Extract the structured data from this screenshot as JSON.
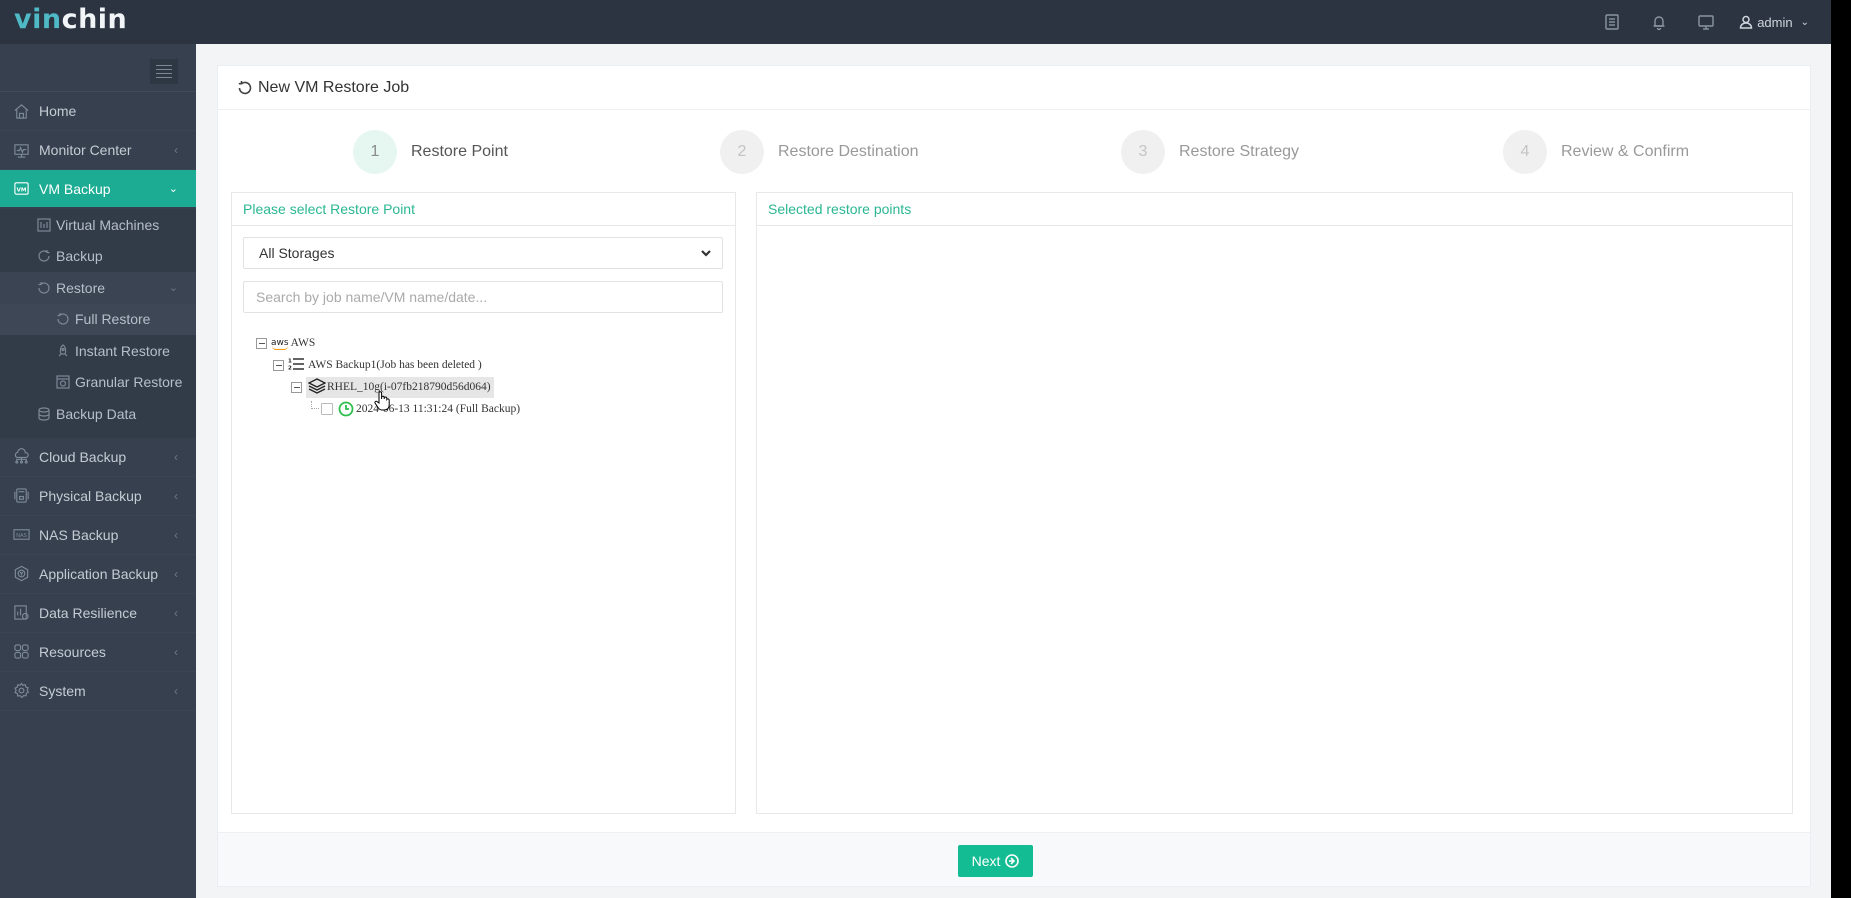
{
  "app": {
    "logo_part1": "vin",
    "logo_part2": "chin",
    "user_name": "admin"
  },
  "topbar_icons": [
    "task-list-icon",
    "bell-icon",
    "monitor-icon",
    "user-icon"
  ],
  "sidebar": {
    "items": [
      {
        "label": "Home",
        "icon": "home-icon"
      },
      {
        "label": "Monitor Center",
        "icon": "monitor-center-icon"
      },
      {
        "label": "VM Backup",
        "icon": "vm-icon",
        "active": true
      },
      {
        "label": "Cloud Backup",
        "icon": "cloud-icon"
      },
      {
        "label": "Physical Backup",
        "icon": "server-icon"
      },
      {
        "label": "NAS Backup",
        "icon": "nas-icon"
      },
      {
        "label": "Application Backup",
        "icon": "app-icon"
      },
      {
        "label": "Data Resilience",
        "icon": "data-resilience-icon"
      },
      {
        "label": "Resources",
        "icon": "resources-icon"
      },
      {
        "label": "System",
        "icon": "gear-icon"
      }
    ],
    "vm_backup_sub": [
      {
        "label": "Virtual Machines"
      },
      {
        "label": "Backup"
      },
      {
        "label": "Restore"
      },
      {
        "label": "Full Restore",
        "current": true
      },
      {
        "label": "Instant Restore"
      },
      {
        "label": "Granular Restore"
      },
      {
        "label": "Backup Data"
      }
    ]
  },
  "page": {
    "title": "New VM Restore Job",
    "steps": [
      {
        "num": "1",
        "label": "Restore Point",
        "active": true
      },
      {
        "num": "2",
        "label": "Restore Destination"
      },
      {
        "num": "3",
        "label": "Restore Strategy"
      },
      {
        "num": "4",
        "label": "Review & Confirm"
      }
    ],
    "left_panel": {
      "title": "Please select Restore Point",
      "storage_select": "All Storages",
      "search_placeholder": "Search by job name/VM name/date..."
    },
    "tree": {
      "root": "AWS",
      "root_logo": "aws",
      "job": "AWS Backup1(Job has been deleted )",
      "vm": "RHEL_10g(i-07fb218790d56d064)",
      "restore_point": "2024-06-13 11:31:24 (Full  Backup)",
      "restore_point_checked": false
    },
    "right_panel": {
      "title": "Selected restore points"
    },
    "next_button": "Next"
  }
}
